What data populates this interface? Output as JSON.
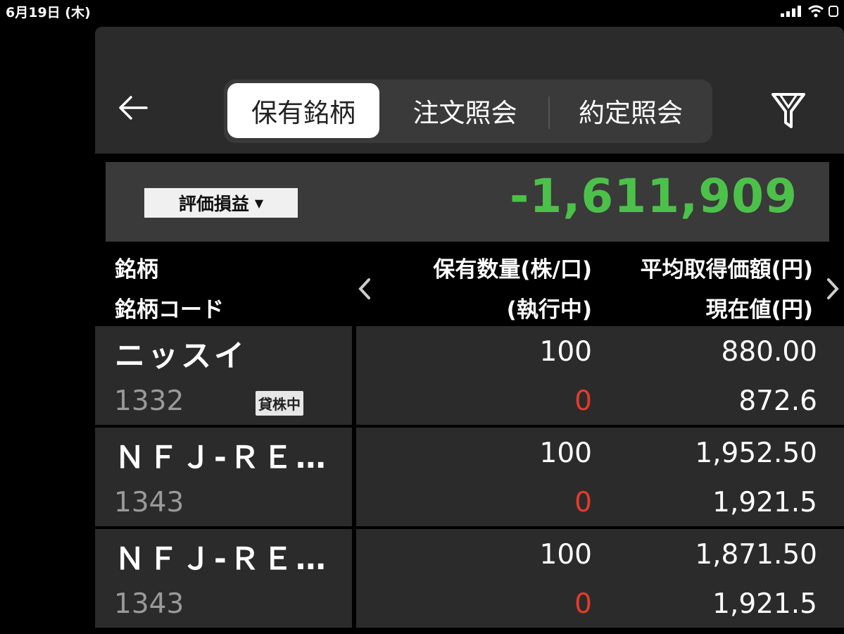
{
  "status_bar": {
    "time": "6月19日 (木)",
    "icons": [
      "signal-icon",
      "wifi-icon",
      "battery-icon"
    ]
  },
  "header": {
    "back_icon": "back-arrow-icon",
    "tabs": [
      {
        "label": "保有銘柄",
        "active": true
      },
      {
        "label": "注文照会",
        "active": false
      },
      {
        "label": "約定照会",
        "active": false
      }
    ],
    "filter_icon": "filter-icon"
  },
  "summary": {
    "toggle_label": "評価損益",
    "toggle_caret": "▼",
    "value": "-1,611,909"
  },
  "columns": {
    "name": "銘柄",
    "code": "銘柄コード",
    "qty": "保有数量(株/口)",
    "executing": "(執行中)",
    "avg_price": "平均取得価額(円)",
    "current": "現在値(円)"
  },
  "holdings": [
    {
      "name": "ニッスイ",
      "code": "1332",
      "badge": "貸株中",
      "qty": "100",
      "executing": "0",
      "avg_price": "880.00",
      "current": "872.6"
    },
    {
      "name": "ＮＦＪ-ＲＥ…",
      "code": "1343",
      "badge": "",
      "qty": "100",
      "executing": "0",
      "avg_price": "1,952.50",
      "current": "1,921.5"
    },
    {
      "name": "ＮＦＪ-ＲＥ…",
      "code": "1343",
      "badge": "",
      "qty": "100",
      "executing": "0",
      "avg_price": "1,871.50",
      "current": "1,921.5"
    }
  ],
  "colors": {
    "gain_loss": "#4cc14a",
    "executing": "#e53a2a",
    "background": "#000000",
    "panel": "#2b2b2b"
  }
}
